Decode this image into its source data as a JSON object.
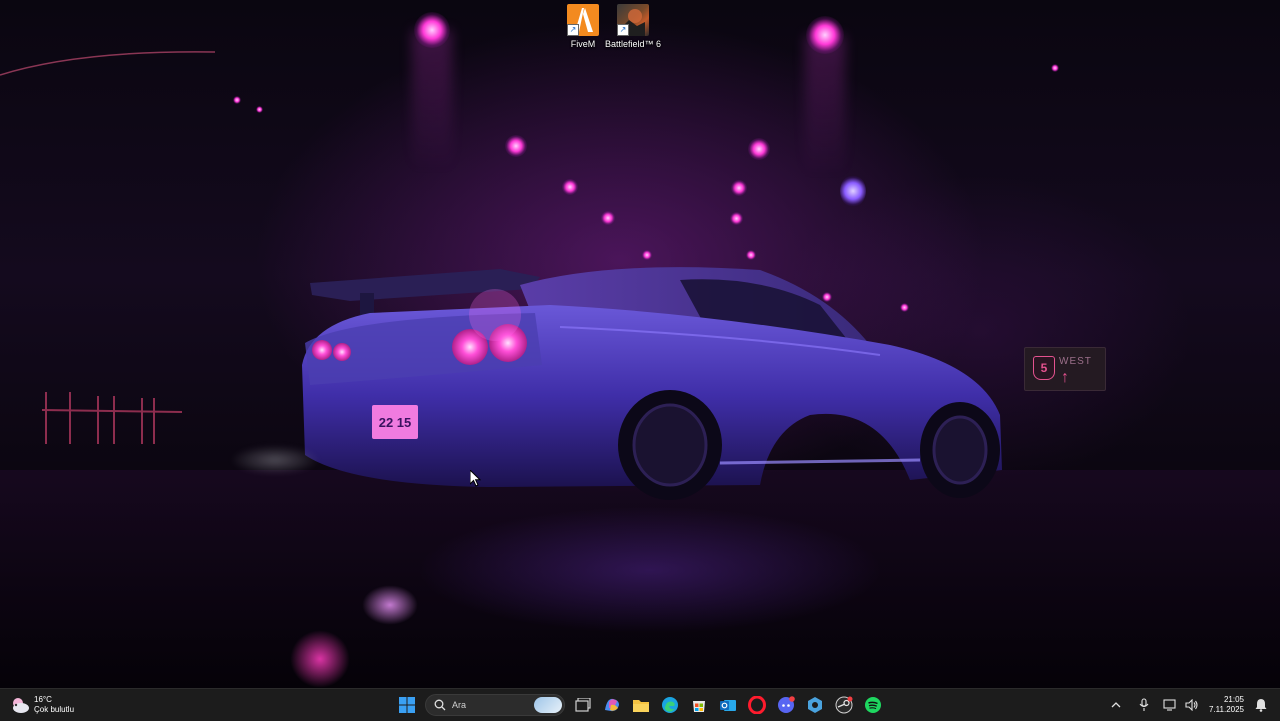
{
  "desktop": {
    "icons": [
      {
        "label": "FiveM",
        "icon": "fivem-app-icon"
      },
      {
        "label": "Battlefield™ 6",
        "icon": "battlefield-app-icon"
      }
    ],
    "wallpaper": {
      "description_icon": "neon-car-wallpaper",
      "road_sign": {
        "route": "5",
        "direction": "WEST"
      },
      "plate": "22 15"
    }
  },
  "taskbar": {
    "weather": {
      "temperature": "16°C",
      "condition": "Çok bulutlu"
    },
    "search": {
      "placeholder": "Ara"
    },
    "pinned_apps": [
      "windows-start-icon",
      "task-view-icon",
      "copilot-m365-icon",
      "file-explorer-icon",
      "edge-browser-icon",
      "microsoft-store-icon",
      "outlook-mail-icon",
      "opera-browser-icon",
      "discord-icon",
      "settings-app-icon",
      "steam-icon",
      "spotify-icon"
    ],
    "clock": {
      "time": "21:05",
      "date": "7.11.2025"
    },
    "colors": {
      "taskbar_bg": "#1c1c1c",
      "accent": "#0078d4"
    }
  }
}
